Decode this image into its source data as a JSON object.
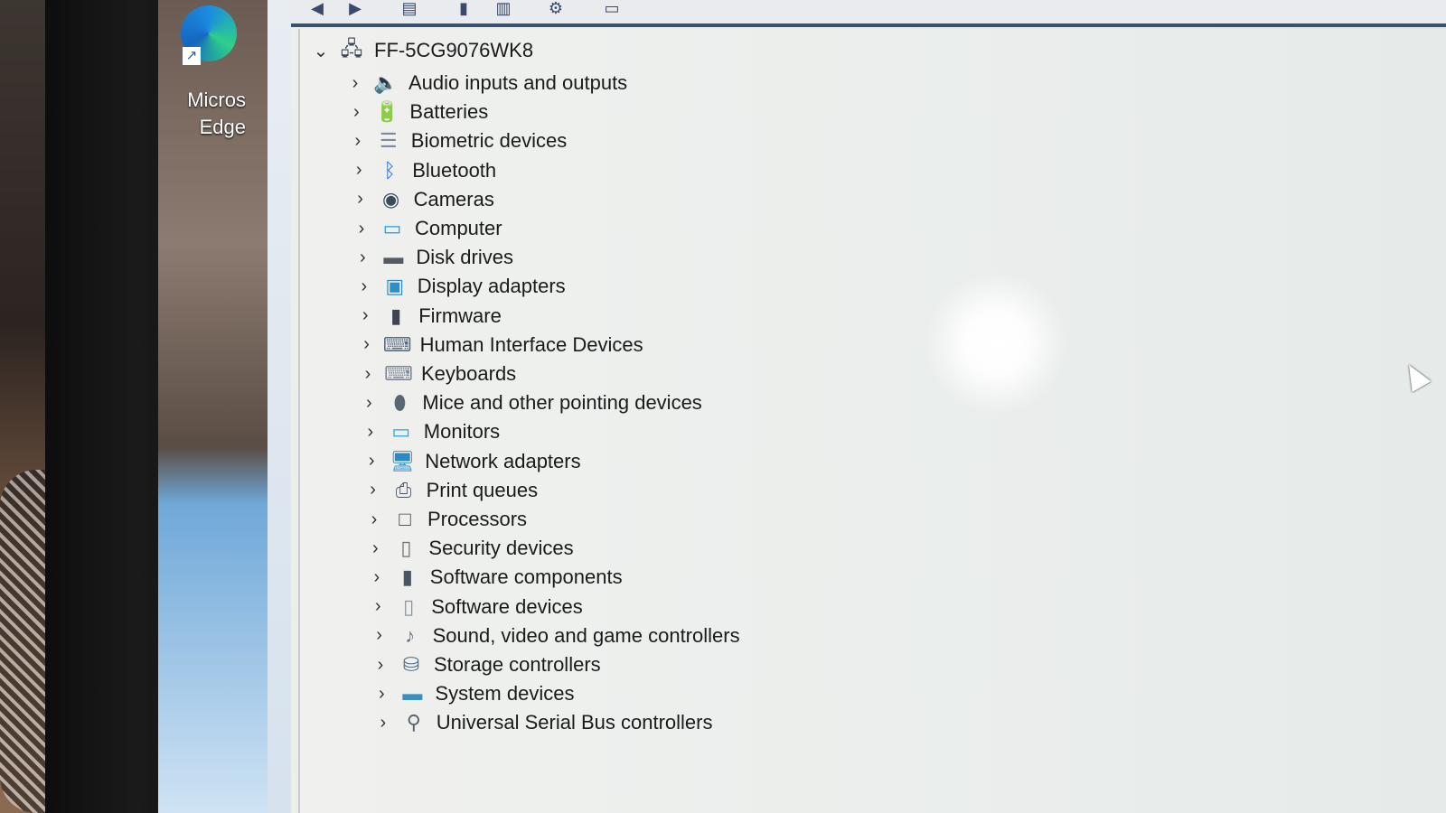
{
  "desktop": {
    "edge_label": "Micros Edge"
  },
  "toolbar": {
    "buttons": [
      "back-icon",
      "forward-icon",
      "properties-icon",
      "update-driver-icon",
      "show-hidden-icon",
      "scan-icon",
      "monitor-icon"
    ]
  },
  "tree": {
    "root": {
      "label": "FF-5CG9076WK8",
      "expanded": true
    },
    "items": [
      {
        "label": "Audio inputs and outputs",
        "icon": "speaker-icon",
        "color": "#4a5b74"
      },
      {
        "label": "Batteries",
        "icon": "battery-icon",
        "color": "#2e7d32"
      },
      {
        "label": "Biometric devices",
        "icon": "fingerprint-icon",
        "color": "#7c8a9c"
      },
      {
        "label": "Bluetooth",
        "icon": "bluetooth-icon",
        "color": "#1e6fd9"
      },
      {
        "label": "Cameras",
        "icon": "camera-icon",
        "color": "#3b4a5c"
      },
      {
        "label": "Computer",
        "icon": "computer-icon",
        "color": "#1f9bd7"
      },
      {
        "label": "Disk drives",
        "icon": "disk-icon",
        "color": "#555b63"
      },
      {
        "label": "Display adapters",
        "icon": "display-adapter-icon",
        "color": "#2c8fc7"
      },
      {
        "label": "Firmware",
        "icon": "firmware-icon",
        "color": "#3d4450"
      },
      {
        "label": "Human Interface Devices",
        "icon": "hid-icon",
        "color": "#5a6a7e"
      },
      {
        "label": "Keyboards",
        "icon": "keyboard-icon",
        "color": "#7b8794"
      },
      {
        "label": "Mice and other pointing devices",
        "icon": "mouse-icon",
        "color": "#5b6674"
      },
      {
        "label": "Monitors",
        "icon": "monitor-icon",
        "color": "#2aa3dc"
      },
      {
        "label": "Network adapters",
        "icon": "network-icon",
        "color": "#2b8ac4"
      },
      {
        "label": "Print queues",
        "icon": "printer-icon",
        "color": "#4d5561"
      },
      {
        "label": "Processors",
        "icon": "processor-icon",
        "color": "#3c4247"
      },
      {
        "label": "Security devices",
        "icon": "security-icon",
        "color": "#6a7076"
      },
      {
        "label": "Software components",
        "icon": "software-components-icon",
        "color": "#4a5563"
      },
      {
        "label": "Software devices",
        "icon": "software-devices-icon",
        "color": "#8a939c"
      },
      {
        "label": "Sound, video and game controllers",
        "icon": "sound-icon",
        "color": "#6b7684"
      },
      {
        "label": "Storage controllers",
        "icon": "storage-icon",
        "color": "#4a6b8a"
      },
      {
        "label": "System devices",
        "icon": "system-icon",
        "color": "#3a8fc0"
      },
      {
        "label": "Universal Serial Bus controllers",
        "icon": "usb-icon",
        "color": "#5a6470"
      }
    ]
  }
}
